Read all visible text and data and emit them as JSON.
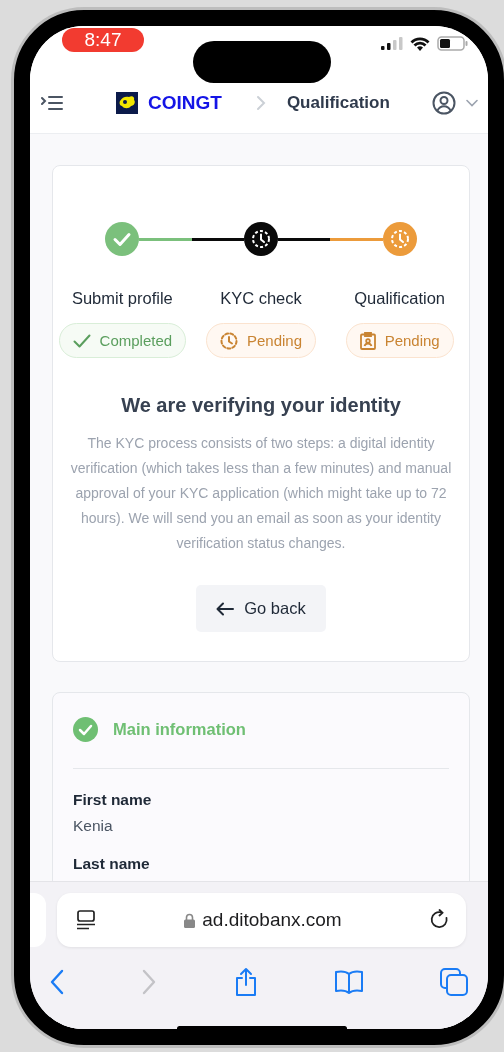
{
  "status_bar": {
    "time": "8:47"
  },
  "header": {
    "brand": "COINGT",
    "breadcrumb": "Qualification"
  },
  "steps": [
    {
      "label": "Submit profile",
      "kind": "done",
      "badge": "Completed"
    },
    {
      "label": "KYC check",
      "kind": "current",
      "badge": "Pending"
    },
    {
      "label": "Qualification",
      "kind": "upcoming",
      "badge": "Pending"
    }
  ],
  "verification": {
    "heading": "We are verifying your identity",
    "description": "The KYC process consists of two steps: a digital identity verification (which takes less than a few minutes) and manual approval of your KYC application (which might take up to 72 hours). We will send you an email as soon as your identity verification status changes.",
    "button": "Go back"
  },
  "section": {
    "title": "Main information",
    "completed": true,
    "fields": [
      {
        "label": "First name",
        "value": "Kenia"
      },
      {
        "label": "Last name"
      }
    ]
  },
  "browser": {
    "url": "ad.ditobanx.com"
  }
}
